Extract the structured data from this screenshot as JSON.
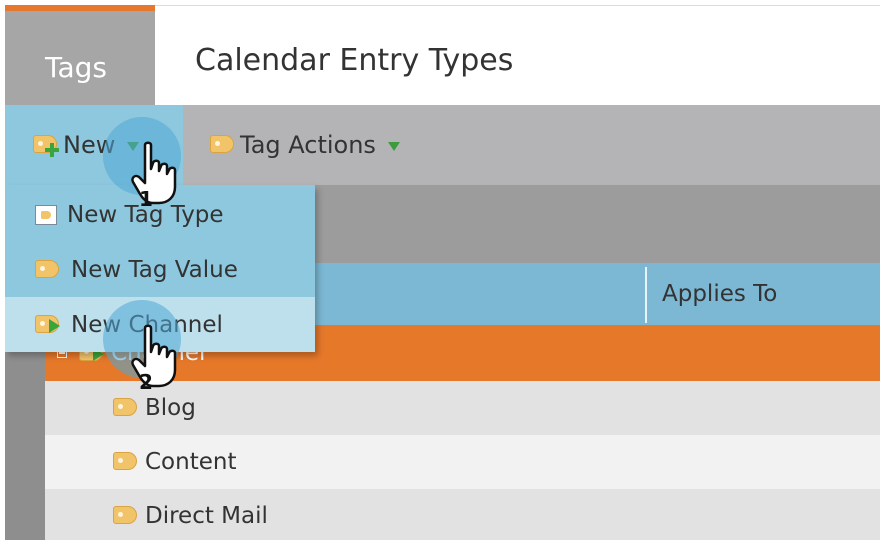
{
  "header": {
    "tab_label": "Tags",
    "title": "Calendar Entry Types"
  },
  "toolbar": {
    "new_label": "New",
    "tag_actions_label": "Tag Actions"
  },
  "menu": {
    "items": [
      {
        "label": "New Tag Type",
        "icon": "tag-type-icon"
      },
      {
        "label": "New Tag Value",
        "icon": "tag-icon"
      },
      {
        "label": "New Channel",
        "icon": "channel-icon"
      }
    ],
    "hovered_index": 2
  },
  "grid": {
    "columns": [
      "Applies To"
    ],
    "rows": [
      {
        "label": "Channel",
        "expanded": true,
        "selected": true
      },
      {
        "label": "Blog"
      },
      {
        "label": "Content"
      },
      {
        "label": "Direct Mail"
      }
    ]
  },
  "callouts": [
    "1",
    "2"
  ],
  "colors": {
    "accent_orange": "#e6782a",
    "menu_blue": "#8ec8de",
    "grid_header_blue": "#7cb8d3"
  }
}
